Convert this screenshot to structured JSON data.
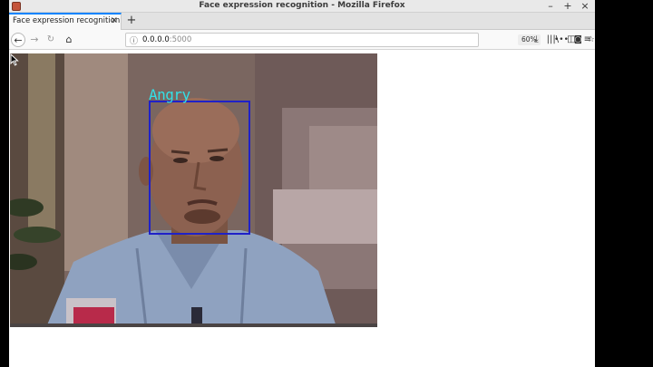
{
  "window": {
    "title": "Face expression recognition - Mozilla Firefox"
  },
  "window_controls": {
    "minimize": "–",
    "maximize": "+",
    "close": "×"
  },
  "tab": {
    "label": "Face expression recognition",
    "close": "×",
    "new_tab": "+"
  },
  "nav": {
    "back": "←",
    "forward": "→",
    "reload": "↻",
    "home": "⌂",
    "url_host": "0.0.0.0",
    "url_port": ":5000",
    "zoom": "60%",
    "more": "•••",
    "pocket": "◙",
    "bookmark": "☆",
    "downloads": "⤓",
    "library": "|||\\",
    "sidebar": "◫",
    "menu": "≡"
  },
  "detection": {
    "label": "Angry",
    "label_color": "#33e0e6",
    "box_color": "#1f21c8"
  },
  "colors": {
    "accent": "#0a84ff"
  }
}
